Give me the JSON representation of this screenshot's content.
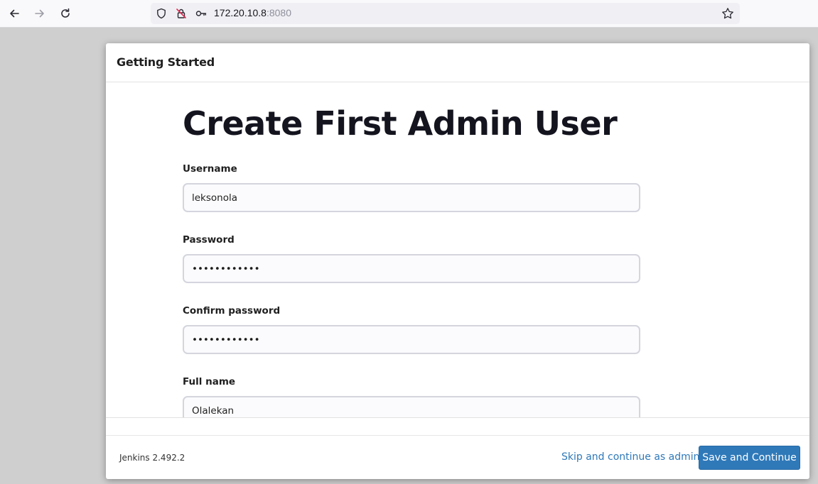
{
  "browser": {
    "url_host": "172.20.10.8",
    "url_port": ":8080"
  },
  "dialog": {
    "header_title": "Getting Started",
    "page_title": "Create First Admin User",
    "fields": {
      "username": {
        "label": "Username",
        "value": "leksonola"
      },
      "password": {
        "label": "Password",
        "value": "leksonola123"
      },
      "confirm_password": {
        "label": "Confirm password",
        "value": "leksonola123"
      },
      "full_name": {
        "label": "Full name",
        "value": "Olalekan"
      }
    },
    "footer": {
      "version": "Jenkins 2.492.2",
      "skip_label": "Skip and continue as admin",
      "save_label": "Save and Continue"
    }
  },
  "colors": {
    "accent": "#2f79b9",
    "page_background": "#cfcfcf"
  },
  "icons": [
    "back-arrow-icon",
    "forward-arrow-icon",
    "reload-icon",
    "shield-icon",
    "insecure-lock-icon",
    "key-icon",
    "star-icon"
  ]
}
